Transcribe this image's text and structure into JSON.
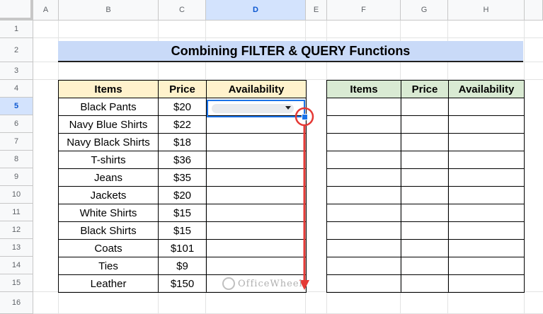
{
  "columns": [
    "A",
    "B",
    "C",
    "D",
    "E",
    "F",
    "G",
    "H"
  ],
  "rows": [
    "1",
    "2",
    "3",
    "4",
    "5",
    "6",
    "7",
    "8",
    "9",
    "10",
    "11",
    "12",
    "13",
    "14",
    "15",
    "16"
  ],
  "title": "Combining FILTER & QUERY Functions",
  "left_table": {
    "headers": [
      "Items",
      "Price",
      "Availability"
    ],
    "rows": [
      [
        "Black Pants",
        "$20",
        ""
      ],
      [
        "Navy Blue Shirts",
        "$22",
        ""
      ],
      [
        "Navy Black Shirts",
        "$18",
        ""
      ],
      [
        "T-shirts",
        "$36",
        ""
      ],
      [
        "Jeans",
        "$35",
        ""
      ],
      [
        "Jackets",
        "$20",
        ""
      ],
      [
        "White Shirts",
        "$15",
        ""
      ],
      [
        "Black Shirts",
        "$15",
        ""
      ],
      [
        "Coats",
        "$101",
        ""
      ],
      [
        "Ties",
        "$9",
        ""
      ],
      [
        "Leather",
        "$150",
        ""
      ]
    ]
  },
  "right_table": {
    "headers": [
      "Items",
      "Price",
      "Availability"
    ],
    "row_count": 11
  },
  "selected_cell": "D5",
  "watermark": "OfficeWheel",
  "colors": {
    "title_bg": "#c9daf8",
    "left_header_bg": "#fff2cc",
    "right_header_bg": "#d9ead3",
    "selection": "#1a73e8",
    "annotation": "#e53935"
  }
}
